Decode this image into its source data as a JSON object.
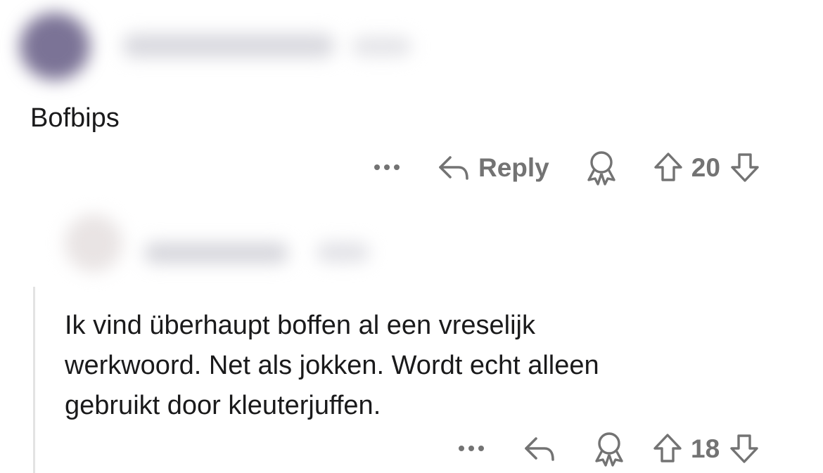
{
  "comment_1": {
    "body": "Bofbips",
    "more_label": "•••",
    "reply_label": "Reply",
    "vote_count": "20",
    "icons": [
      "more-icon",
      "reply-icon",
      "award-icon",
      "upvote-icon",
      "downvote-icon"
    ]
  },
  "comment_2": {
    "body": "Ik vind überhaupt boffen al een vreselijk\nwerkwoord. Net als jokken. Wordt echt alleen\ngebruikt door kleuterjuffen.",
    "more_label": "•••",
    "vote_count": "18",
    "icons": [
      "more-icon",
      "reply-icon",
      "award-icon",
      "upvote-icon",
      "downvote-icon"
    ]
  },
  "colors": {
    "text": "#1a1a1b",
    "muted": "#737373",
    "thread_line": "#e3e3e3"
  }
}
